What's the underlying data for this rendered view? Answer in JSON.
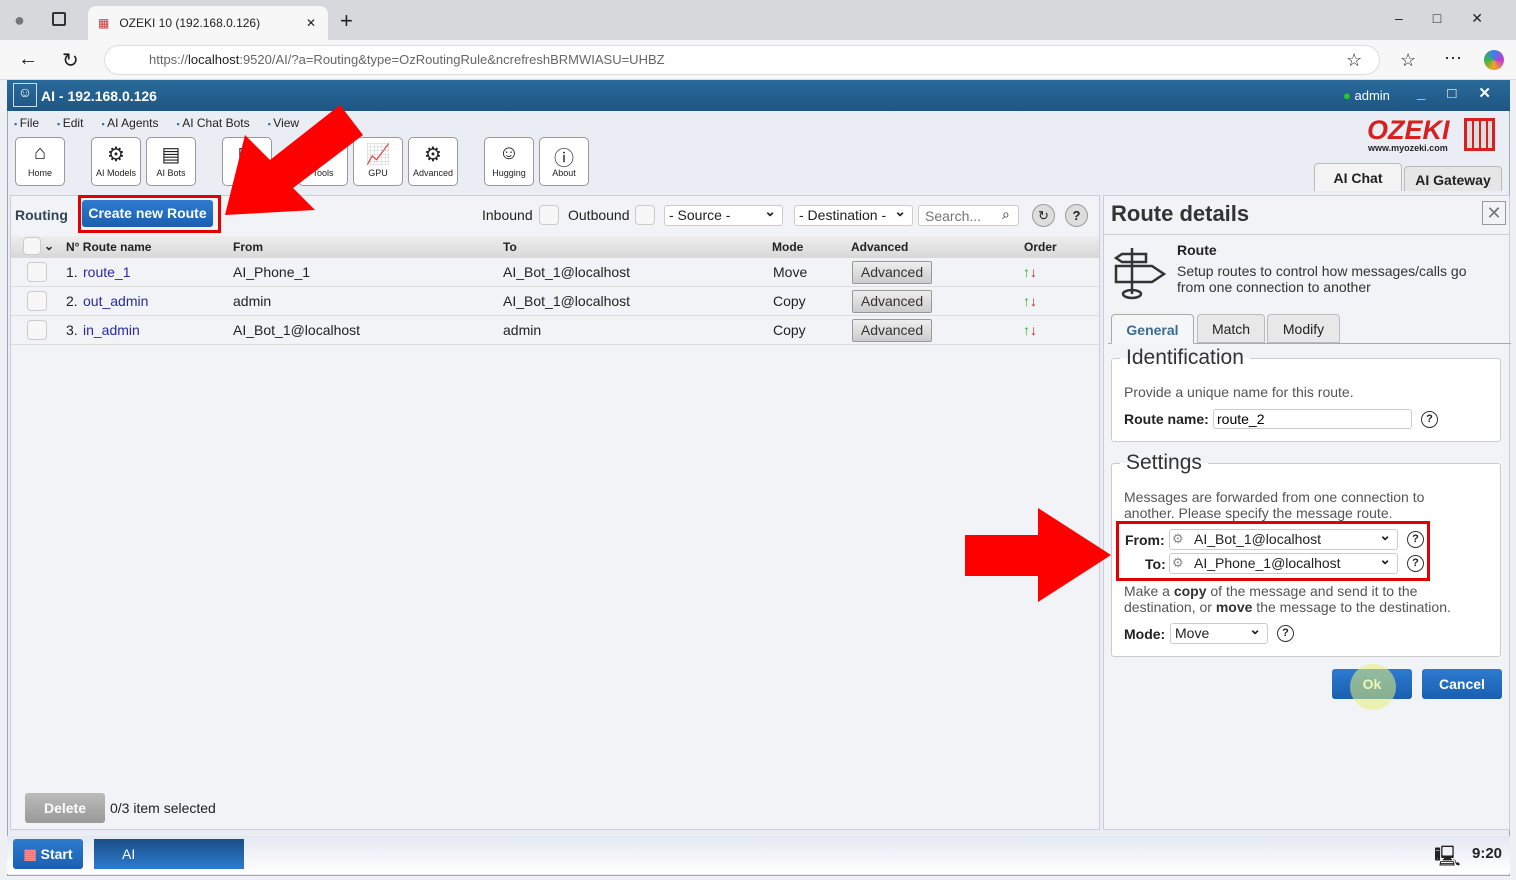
{
  "browser": {
    "tab_title": "OZEKI 10 (192.168.0.126)",
    "url_prefix": "https://",
    "url_host": "localhost",
    "url_rest": ":9520/AI/?a=Routing&type=OzRoutingRule&ncrefreshBRMWIASU=UHBZ"
  },
  "app": {
    "title": "AI - 192.168.0.126",
    "user": "admin",
    "logo": "OZEKI",
    "logo_sub": "www.myozeki.com"
  },
  "menu": [
    "File",
    "Edit",
    "AI Agents",
    "AI Chat Bots",
    "View",
    "Help"
  ],
  "toolbar": [
    "Home",
    "AI Models",
    "AI Bots",
    "G",
    "Tools",
    "GPU",
    "Advanced",
    "Hugging",
    "About"
  ],
  "top_tabs": [
    "AI Chat",
    "AI Gateway"
  ],
  "routing": {
    "label": "Routing",
    "create_button": "Create new Route",
    "inbound": "Inbound",
    "outbound": "Outbound",
    "source": "- Source -",
    "destination": "- Destination -",
    "search_placeholder": "Search..."
  },
  "table": {
    "headers": [
      "N° Route name",
      "From",
      "To",
      "Mode",
      "Advanced",
      "Order"
    ],
    "rows": [
      {
        "n": "1.",
        "name": "route_1",
        "from": "AI_Phone_1",
        "to": "AI_Bot_1@localhost",
        "mode": "Move",
        "adv": "Advanced"
      },
      {
        "n": "2.",
        "name": "out_admin",
        "from": "admin",
        "to": "AI_Bot_1@localhost",
        "mode": "Copy",
        "adv": "Advanced"
      },
      {
        "n": "3.",
        "name": "in_admin",
        "from": "AI_Bot_1@localhost",
        "to": "admin",
        "mode": "Copy",
        "adv": "Advanced"
      }
    ]
  },
  "footer": {
    "delete": "Delete",
    "selected": "0/3 item selected"
  },
  "details": {
    "title": "Route details",
    "route_title": "Route",
    "route_desc": "Setup routes to control how messages/calls go from one connection to another",
    "tabs": [
      "General",
      "Match",
      "Modify"
    ],
    "identification": "Identification",
    "id_hint": "Provide a unique name for this route.",
    "route_name_label": "Route name:",
    "route_name": "route_2",
    "settings": "Settings",
    "settings_hint": "Messages are forwarded from one connection to another. Please specify the message route.",
    "from_label": "From:",
    "from": "AI_Bot_1@localhost",
    "to_label": "To:",
    "to": "AI_Phone_1@localhost",
    "mode_hint_1": "Make a ",
    "mode_hint_copy": "copy",
    "mode_hint_2": " of the message and send it to the destination, or ",
    "mode_hint_move": "move",
    "mode_hint_3": " the message to the destination.",
    "mode_label": "Mode:",
    "mode": "Move",
    "ok": "Ok",
    "cancel": "Cancel"
  },
  "taskbar": {
    "start": "Start",
    "app": "AI",
    "clock": "9:20"
  },
  "colors": {
    "highlight": "#e30000",
    "titlebar": "#1d5684",
    "button": "#1a5fb0"
  }
}
